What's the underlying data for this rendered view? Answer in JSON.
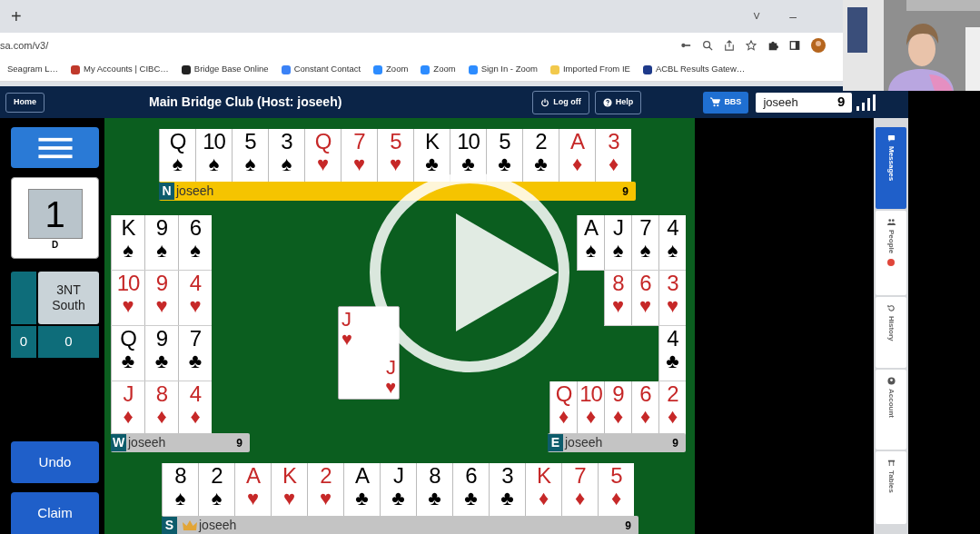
{
  "browser": {
    "new_tab": "+",
    "window_controls": [
      "˅",
      "–"
    ],
    "address": "sa.com/v3/",
    "bookmarks": [
      {
        "label": "Seagram L…"
      },
      {
        "label": "My Accounts | CIBC…",
        "color": "#c0392b"
      },
      {
        "label": "Bridge Base Online",
        "color": "#222222"
      },
      {
        "label": "Constant Contact",
        "color": "#3b82f6"
      },
      {
        "label": "Zoom",
        "color": "#2d8cff"
      },
      {
        "label": "Zoom",
        "color": "#2d8cff"
      },
      {
        "label": "Sign In - Zoom",
        "color": "#2d8cff"
      },
      {
        "label": "Imported From IE",
        "color": "#f2c94c"
      },
      {
        "label": "ACBL Results Gatew…",
        "color": "#1e3a8a"
      }
    ]
  },
  "app": {
    "home_button": "Home",
    "title": "Main Bridge Club (Host: joseeh)",
    "header_buttons": [
      {
        "label": "Log off",
        "kind": "power"
      },
      {
        "label": "Help",
        "kind": "help"
      }
    ],
    "bbs_button": "BBS",
    "username": "joseeh",
    "count": "9"
  },
  "left_panel": {
    "board_number": "1",
    "dealer": "D",
    "contract": "3NT",
    "declarer": "South",
    "tricks": [
      "0",
      "0"
    ],
    "buttons": [
      "Undo",
      "Claim"
    ]
  },
  "hands": [
    {
      "seat": "N",
      "player": "joseeh",
      "tricks": "9",
      "active": true,
      "declarer": false,
      "suits": [
        {
          "color": "#000000",
          "symbol": "♠",
          "ranks": [
            "Q",
            "10",
            "5",
            "3"
          ]
        },
        {
          "color": "#c62828",
          "symbol": "♥",
          "ranks": [
            "Q",
            "7",
            "5"
          ]
        },
        {
          "color": "#000000",
          "symbol": "♣",
          "ranks": [
            "K",
            "10",
            "5",
            "2"
          ]
        },
        {
          "color": "#c62828",
          "symbol": "♦",
          "ranks": [
            "A",
            "3"
          ]
        }
      ]
    },
    {
      "seat": "W",
      "player": "joseeh",
      "tricks": "9",
      "active": false,
      "declarer": false,
      "suits": [
        {
          "color": "#000000",
          "symbol": "♠",
          "ranks": [
            "K",
            "9",
            "6"
          ]
        },
        {
          "color": "#c62828",
          "symbol": "♥",
          "ranks": [
            "10",
            "9",
            "4"
          ]
        },
        {
          "color": "#000000",
          "symbol": "♣",
          "ranks": [
            "Q",
            "9",
            "7"
          ]
        },
        {
          "color": "#c62828",
          "symbol": "♦",
          "ranks": [
            "J",
            "8",
            "4"
          ]
        }
      ]
    },
    {
      "seat": "E",
      "player": "joseeh",
      "tricks": "9",
      "active": false,
      "declarer": false,
      "suits": [
        {
          "color": "#000000",
          "symbol": "♠",
          "ranks": [
            "A",
            "J",
            "7",
            "4"
          ]
        },
        {
          "color": "#c62828",
          "symbol": "♥",
          "ranks": [
            "8",
            "6",
            "3"
          ]
        },
        {
          "color": "#000000",
          "symbol": "♣",
          "ranks": [
            "4"
          ]
        },
        {
          "color": "#c62828",
          "symbol": "♦",
          "ranks": [
            "Q",
            "10",
            "9",
            "6",
            "2"
          ]
        }
      ]
    },
    {
      "seat": "S",
      "player": "joseeh",
      "tricks": "9",
      "active": false,
      "declarer": true,
      "suits": [
        {
          "color": "#000000",
          "symbol": "♠",
          "ranks": [
            "8",
            "2"
          ]
        },
        {
          "color": "#c62828",
          "symbol": "♥",
          "ranks": [
            "A",
            "K",
            "2"
          ]
        },
        {
          "color": "#000000",
          "symbol": "♣",
          "ranks": [
            "A",
            "J",
            "8",
            "6",
            "3"
          ]
        },
        {
          "color": "#c62828",
          "symbol": "♦",
          "ranks": [
            "K",
            "7",
            "5"
          ]
        }
      ]
    }
  ],
  "played_card": {
    "color": "#c62828",
    "corners": [
      {
        "rank": "J",
        "symbol": "♥"
      },
      {
        "rank": "J",
        "symbol": "♥"
      }
    ]
  },
  "sidebar_tabs": [
    {
      "label": "Messages",
      "kind": "messages",
      "selected": true,
      "notification": false
    },
    {
      "label": "People",
      "kind": "people",
      "selected": false,
      "notification": true
    },
    {
      "label": "History",
      "kind": "history",
      "selected": false,
      "notification": false
    },
    {
      "label": "Account",
      "kind": "account",
      "selected": false,
      "notification": false
    },
    {
      "label": "Tables",
      "kind": "tables",
      "selected": false,
      "notification": false
    }
  ]
}
